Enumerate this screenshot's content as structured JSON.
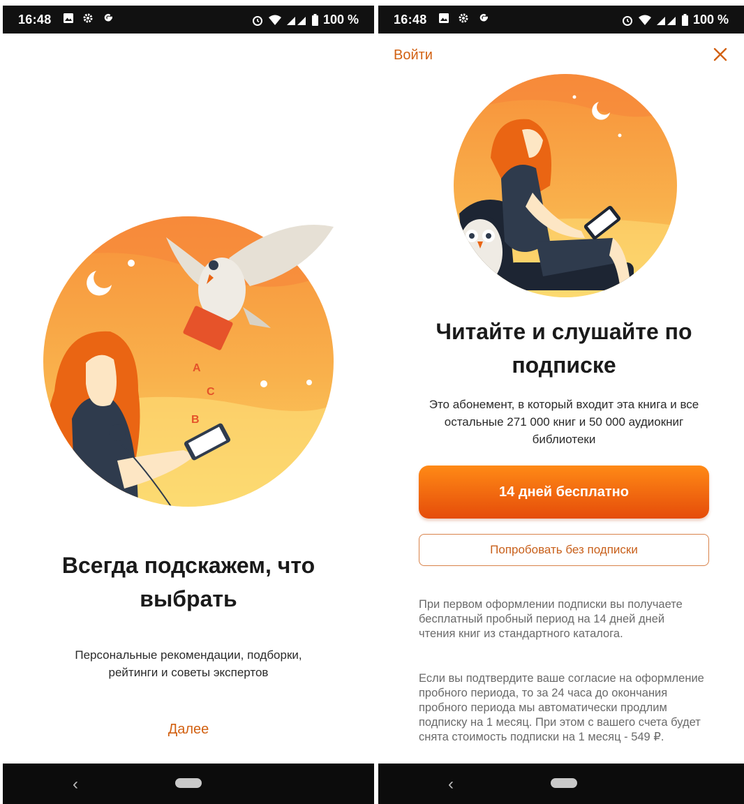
{
  "status_bar": {
    "time": "16:48",
    "battery": "100 %"
  },
  "left_screen": {
    "title": "Всегда подскажем, что выбрать",
    "subtitle": "Персональные рекомендации, подборки, рейтинги и советы экспертов",
    "next_link": "Далее",
    "illustration_letters": [
      "A",
      "C",
      "B"
    ]
  },
  "right_screen": {
    "login_link": "Войти",
    "close_icon": "close-icon",
    "title": "Читайте и слушайте по подписке",
    "subtitle": "Это абонемент, в который входит эта книга и все остальные 271 000 книг и 50 000 аудиокниг библиотеки",
    "primary_button": "14 дней бесплатно",
    "secondary_button": "Попробовать без подписки",
    "legal_paragraph_1": "При первом оформлении подписки вы получаете бесплатный пробный период на 14 дней дней чтения книг из стандартного каталога.",
    "legal_paragraph_2": "Если вы подтвердите ваше согласие на оформление пробного периода, то за 24 часа до окончания пробного периода мы автоматически продлим подписку на 1 месяц. При этом с вашего счета будет снята стоимость подписки на 1 месяц - 549 ₽."
  },
  "colors": {
    "accent": "#d26112",
    "button_top": "#ff8a16",
    "button_bottom": "#e54c0a",
    "status_bar": "#111111"
  }
}
